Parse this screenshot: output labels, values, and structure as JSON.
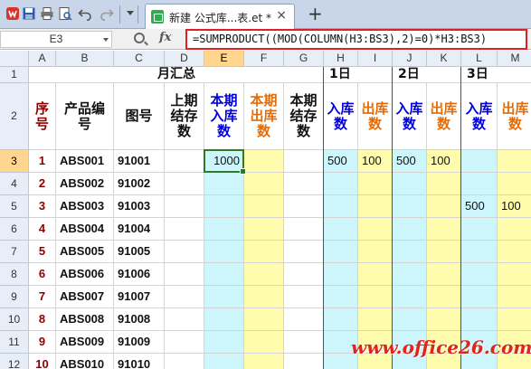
{
  "titlebar": {
    "tab_label": "新建 公式库...表.et *",
    "icons": [
      "wps-logo-icon",
      "save-icon",
      "print-icon",
      "print-preview-icon",
      "undo-icon",
      "redo-icon",
      "dropdown-icon",
      "sheet-file-icon",
      "close-icon",
      "new-tab-icon"
    ],
    "tab_close": "×",
    "new_tab": "+"
  },
  "formula_bar": {
    "name_box": "E3",
    "fx_label": "fx",
    "formula": "=SUMPRODUCT((MOD(COLUMN(H3:BS3),2)=0)*H3:BS3)"
  },
  "columns": [
    "A",
    "B",
    "C",
    "D",
    "E",
    "F",
    "G",
    "H",
    "I",
    "J",
    "K",
    "L",
    "M"
  ],
  "selected_column": "E",
  "selected_row": "3",
  "rows": [
    "1",
    "2",
    "3",
    "4",
    "5",
    "6",
    "7",
    "8",
    "9",
    "10",
    "11",
    "12"
  ],
  "header_row1": {
    "summary": "月汇总",
    "day1": "1日",
    "day2": "2日",
    "day3": "3日"
  },
  "header_row2": {
    "seq": "序号",
    "product_code": "产品编号",
    "drawing_no": "图号",
    "prev_stock": "上期结存数",
    "cur_in": "本期入库数",
    "cur_out": "本期出库数",
    "cur_stock": "本期结存数",
    "in1": "入库数",
    "out1": "出库数",
    "in2": "入库数",
    "out2": "出库数",
    "in3": "入库数",
    "out3": "出库数"
  },
  "data_rows": [
    {
      "seq": "1",
      "code": "ABS001",
      "drawing": "91001",
      "E": "1000",
      "H": "500",
      "I": "100",
      "J": "500",
      "K": "100",
      "L": "",
      "M": ""
    },
    {
      "seq": "2",
      "code": "ABS002",
      "drawing": "91002",
      "E": "",
      "H": "",
      "I": "",
      "J": "",
      "K": "",
      "L": "",
      "M": ""
    },
    {
      "seq": "3",
      "code": "ABS003",
      "drawing": "91003",
      "E": "",
      "H": "",
      "I": "",
      "J": "",
      "K": "",
      "L": "500",
      "M": "100"
    },
    {
      "seq": "4",
      "code": "ABS004",
      "drawing": "91004",
      "E": "",
      "H": "",
      "I": "",
      "J": "",
      "K": "",
      "L": "",
      "M": ""
    },
    {
      "seq": "5",
      "code": "ABS005",
      "drawing": "91005",
      "E": "",
      "H": "",
      "I": "",
      "J": "",
      "K": "",
      "L": "",
      "M": ""
    },
    {
      "seq": "6",
      "code": "ABS006",
      "drawing": "91006",
      "E": "",
      "H": "",
      "I": "",
      "J": "",
      "K": "",
      "L": "",
      "M": ""
    },
    {
      "seq": "7",
      "code": "ABS007",
      "drawing": "91007",
      "E": "",
      "H": "",
      "I": "",
      "J": "",
      "K": "",
      "L": "",
      "M": ""
    },
    {
      "seq": "8",
      "code": "ABS008",
      "drawing": "91008",
      "E": "",
      "H": "",
      "I": "",
      "J": "",
      "K": "",
      "L": "",
      "M": ""
    },
    {
      "seq": "9",
      "code": "ABS009",
      "drawing": "91009",
      "E": "",
      "H": "",
      "I": "",
      "J": "",
      "K": "",
      "L": "",
      "M": ""
    },
    {
      "seq": "10",
      "code": "ABS010",
      "drawing": "91010",
      "E": "",
      "H": "",
      "I": "",
      "J": "",
      "K": "",
      "L": "",
      "M": ""
    }
  ],
  "colors": {
    "seq_text": "#8b0000",
    "in_text": "#0000dd",
    "out_text": "#e36c09",
    "in_fill": "#ccf6fb",
    "out_fill": "#fffcad",
    "selection": "#2d7a2d",
    "formula_highlight": "#e02020",
    "watermark": "#e2231a"
  },
  "watermark": "www.office26.com"
}
